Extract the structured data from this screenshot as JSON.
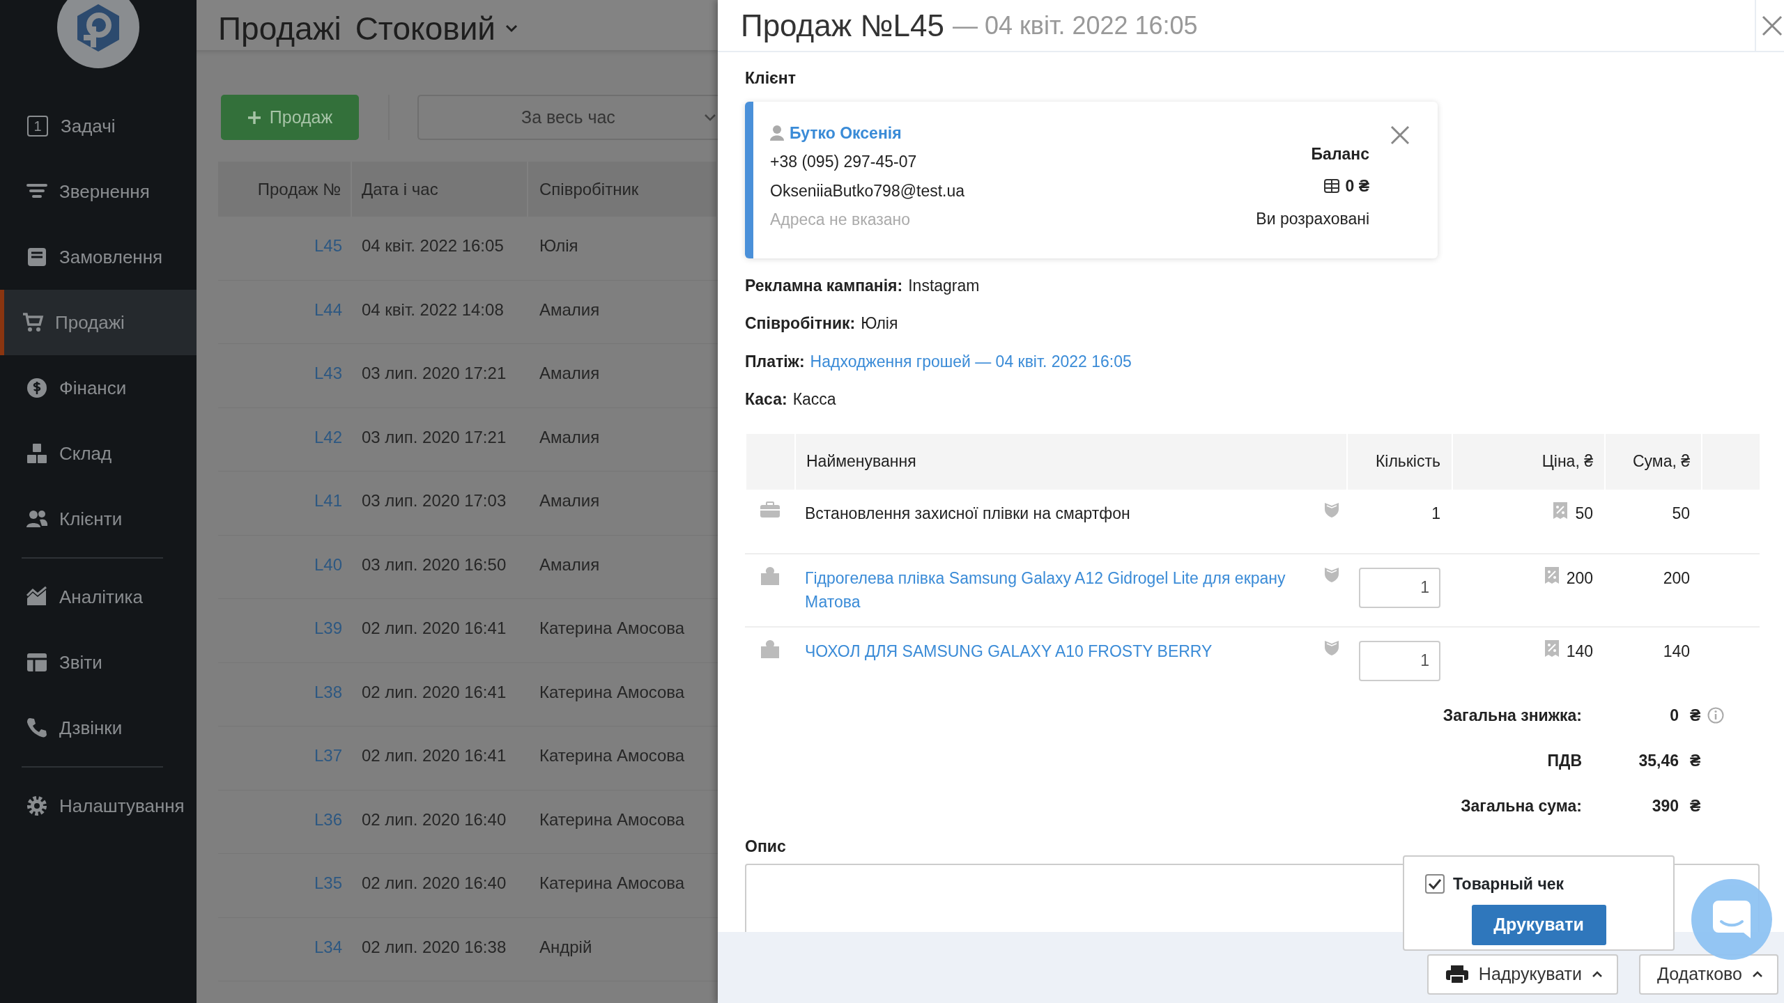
{
  "sidebar": {
    "groups": [
      [
        {
          "label": "Задачі",
          "badge": "1",
          "selected": false
        },
        {
          "label": "Звернення",
          "selected": false
        },
        {
          "label": "Замовлення",
          "selected": false
        },
        {
          "label": "Продажі",
          "selected": true
        },
        {
          "label": "Фінанси",
          "selected": false
        },
        {
          "label": "Склад",
          "selected": false
        },
        {
          "label": "Клієнти",
          "selected": false
        }
      ],
      [
        {
          "label": "Аналітика",
          "selected": false
        },
        {
          "label": "Звіти",
          "selected": false
        },
        {
          "label": "Дзвінки",
          "selected": false
        }
      ],
      [
        {
          "label": "Налаштування",
          "selected": false
        }
      ]
    ]
  },
  "main": {
    "title": "Продажі",
    "view": "Стоковий",
    "add_button": "Продаж",
    "period": "За весь час",
    "table": {
      "columns": [
        "Продаж №",
        "Дата і час",
        "Співробітник"
      ],
      "rows": [
        {
          "number": "L45",
          "date": "04 квіт. 2022 16:05",
          "employee": "Юлія"
        },
        {
          "number": "L44",
          "date": "04 квіт. 2022 14:08",
          "employee": "Амалия"
        },
        {
          "number": "L43",
          "date": "03 лип. 2020 17:21",
          "employee": "Амалия"
        },
        {
          "number": "L42",
          "date": "03 лип. 2020 17:21",
          "employee": "Амалия"
        },
        {
          "number": "L41",
          "date": "03 лип. 2020 17:03",
          "employee": "Амалия"
        },
        {
          "number": "L40",
          "date": "03 лип. 2020 16:50",
          "employee": "Амалия"
        },
        {
          "number": "L39",
          "date": "02 лип. 2020 16:41",
          "employee": "Катерина Амосова"
        },
        {
          "number": "L38",
          "date": "02 лип. 2020 16:41",
          "employee": "Катерина Амосова"
        },
        {
          "number": "L37",
          "date": "02 лип. 2020 16:41",
          "employee": "Катерина Амосова"
        },
        {
          "number": "L36",
          "date": "02 лип. 2020 16:40",
          "employee": "Катерина Амосова"
        },
        {
          "number": "L35",
          "date": "02 лип. 2020 16:40",
          "employee": "Катерина Амосова"
        },
        {
          "number": "L34",
          "date": "02 лип. 2020 16:38",
          "employee": "Андрій"
        }
      ]
    }
  },
  "panel": {
    "title": "Продаж №L45",
    "subtitle": "— 04 квіт. 2022 16:05",
    "client_label": "Клієнт",
    "client": {
      "name": "Бутко Оксенія",
      "phone": "+38 (095) 297-45-07",
      "email": "OkseniiaButko798@test.ua",
      "address": "Адреса не вказано",
      "balance_label": "Баланс",
      "balance": "0 ₴",
      "balance_status": "Ви розраховані"
    },
    "fields": [
      {
        "label": "Рекламна кампанія:",
        "value": "Instagram",
        "kind": "text"
      },
      {
        "label": "Співробітник:",
        "value": "Юлія",
        "kind": "text"
      },
      {
        "label": "Платіж:",
        "value": "Надходження грошей — 04 квіт. 2022 16:05",
        "kind": "link"
      },
      {
        "label": "Каса:",
        "value": "Касса",
        "kind": "text"
      }
    ],
    "items_table": {
      "columns": [
        "Найменування",
        "Кількість",
        "Ціна, ₴",
        "Сума, ₴"
      ],
      "rows": [
        {
          "kind": "service",
          "name": "Встановлення захисної плівки на смартфон",
          "quantity": "1",
          "price": "50",
          "sum": "50"
        },
        {
          "kind": "product",
          "name": "Гідрогелева плівка Samsung Galaxy A12 Gidrogel Lite для екрану Матова",
          "quantity": "1",
          "price": "200",
          "sum": "200"
        },
        {
          "kind": "product",
          "name": "ЧОХОЛ ДЛЯ SAMSUNG GALAXY A10 FROSTY BERRY",
          "quantity": "1",
          "price": "140",
          "sum": "140"
        }
      ]
    },
    "totals": [
      {
        "label": "Загальна знижка:",
        "value": "0",
        "currency": "₴",
        "info": true
      },
      {
        "label": "ПДВ",
        "value": "35,46",
        "currency": "₴",
        "info": false
      },
      {
        "label": "Загальна сума:",
        "value": "390",
        "currency": "₴",
        "info": false
      }
    ],
    "description_label": "Опис",
    "print_popover": {
      "checkbox_label": "Товарный чек",
      "checked": true,
      "button": "Друкувати"
    },
    "footer_buttons": [
      {
        "label": "Надрукувати",
        "kind": "print"
      },
      {
        "label": "Додатково",
        "kind": "more"
      }
    ]
  }
}
